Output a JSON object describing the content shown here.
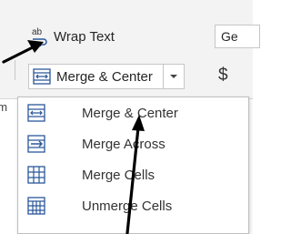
{
  "ribbon": {
    "wrap_text_label": "Wrap Text",
    "wrap_icon_text": "ab",
    "merge_center_label": "Merge & Center",
    "number_format_partial": "Ge",
    "currency_symbol": "$",
    "group_label_partial": "nm"
  },
  "menu": {
    "items": [
      {
        "label": "Merge & Center",
        "icon": "merge-center-icon"
      },
      {
        "label": "Merge Across",
        "icon": "merge-across-icon"
      },
      {
        "label": "Merge Cells",
        "icon": "merge-cells-icon"
      },
      {
        "label": "Unmerge Cells",
        "icon": "unmerge-cells-icon"
      }
    ]
  },
  "colors": {
    "icon_blue": "#2b579a",
    "arrow": "#000000",
    "ribbon_bg": "#f3f3f3"
  }
}
